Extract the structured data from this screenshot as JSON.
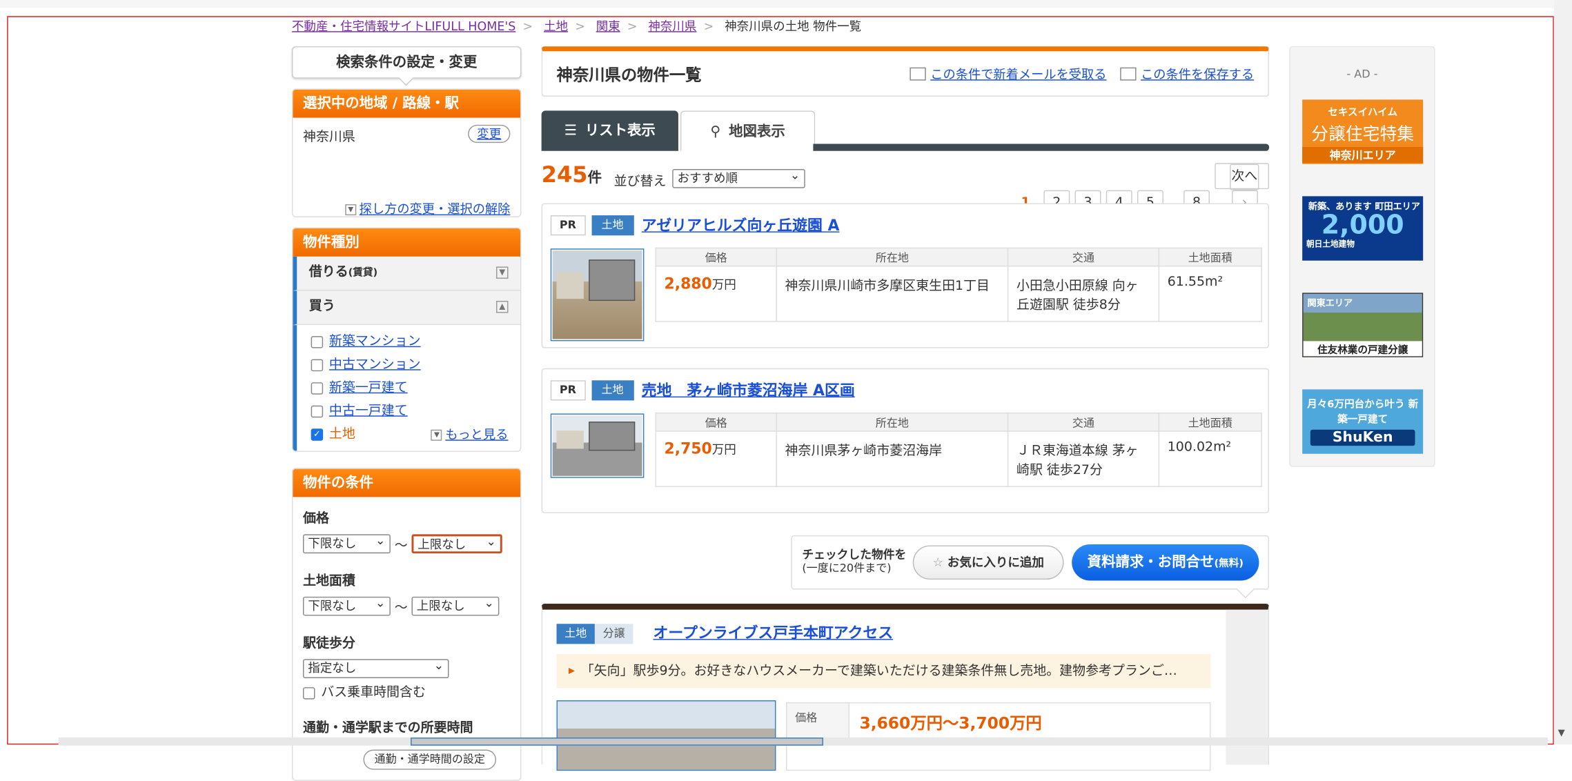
{
  "breadcrumb": {
    "items": [
      "不動産・住宅情報サイトLIFULL HOME'S",
      "土地",
      "関東",
      "神奈川県"
    ],
    "current": "神奈川県の土地 物件一覧"
  },
  "sidebar": {
    "cond_button": "検索条件の設定・変更",
    "region": {
      "header": "選択中の地域 / 路線・駅",
      "value": "神奈川県",
      "change": "変更",
      "howto": "探し方の変更・選択の解除"
    },
    "types": {
      "header": "物件種別",
      "rent": "借りる",
      "rent_sub": "(賃貸)",
      "buy": "買う",
      "items": [
        {
          "label": "新築マンション",
          "checked": false
        },
        {
          "label": "中古マンション",
          "checked": false
        },
        {
          "label": "新築一戸建て",
          "checked": false
        },
        {
          "label": "中古一戸建て",
          "checked": false
        },
        {
          "label": "土地",
          "checked": true
        }
      ],
      "more": "もっと見る"
    },
    "conditions": {
      "header": "物件の条件",
      "price_label": "価格",
      "price_min": "下限なし",
      "price_max": "上限なし",
      "area_label": "土地面積",
      "area_min": "下限なし",
      "area_max": "上限なし",
      "walk_label": "駅徒歩分",
      "walk_value": "指定なし",
      "bus": "バス乗車時間含む",
      "commute_label": "通勤・通学駅までの所要時間",
      "commute_button": "通勤・通学時間の設定",
      "tilde": "〜"
    }
  },
  "main": {
    "title": "神奈川県の物件一覧",
    "mail_link": "この条件で新着メールを受取る",
    "save_link": "この条件を保存する",
    "tab_list": "リスト表示",
    "tab_map": "地図表示",
    "count": "245",
    "count_unit": "件",
    "sort_label": "並び替え",
    "sort_value": "おすすめ順",
    "pages": [
      "1",
      "2",
      "3",
      "4",
      "5",
      "…",
      "8"
    ],
    "next": "次へ",
    "table_headers": [
      "価格",
      "所在地",
      "交通",
      "土地面積"
    ],
    "listings": [
      {
        "pr": "PR",
        "tag": "土地",
        "name": "アゼリアヒルズ向ヶ丘遊園 A",
        "price": "2,880",
        "price_unit": "万円",
        "address": "神奈川県川崎市多摩区東生田1丁目",
        "access": "小田急小田原線 向ヶ丘遊園駅 徒歩8分",
        "area": "61.55m²"
      },
      {
        "pr": "PR",
        "tag": "土地",
        "name": "売地　茅ヶ崎市菱沼海岸 A区画",
        "price": "2,750",
        "price_unit": "万円",
        "address": "神奈川県茅ヶ崎市菱沼海岸",
        "access": "ＪＲ東海道本線 茅ヶ崎駅 徒歩27分",
        "area": "100.02m²"
      }
    ],
    "cta": {
      "text1": "チェックした物件を",
      "text2": "(一度に20件まで)",
      "fav": "お気に入りに追加",
      "inquiry": "資料請求・お問合せ",
      "inquiry_sub": "(無料)"
    },
    "featured": {
      "tag1": "土地",
      "tag2": "分譲",
      "name": "オープンライブス戸手本町アクセス",
      "catch": "「矢向」駅歩9分。お好きなハウスメーカーで建築いただける建築条件無し売地。建物参考プランご…",
      "price_label": "価格",
      "price": "3,660万円〜3,700万円"
    }
  },
  "ads": {
    "label": "- AD -",
    "ad1": {
      "a": "セキスイハイム",
      "b": "分譲住宅特集",
      "c": "神奈川エリア"
    },
    "ad2": {
      "a": "新築、あります 町田エリア",
      "b": "2,000",
      "c": "朝日土地建物"
    },
    "ad3": {
      "a": "関東エリア",
      "c": "住友林業の戸建分譲"
    },
    "ad4": {
      "a": "月々6万円台から叶う 新築一戸建て",
      "c": "ShuKen"
    }
  }
}
